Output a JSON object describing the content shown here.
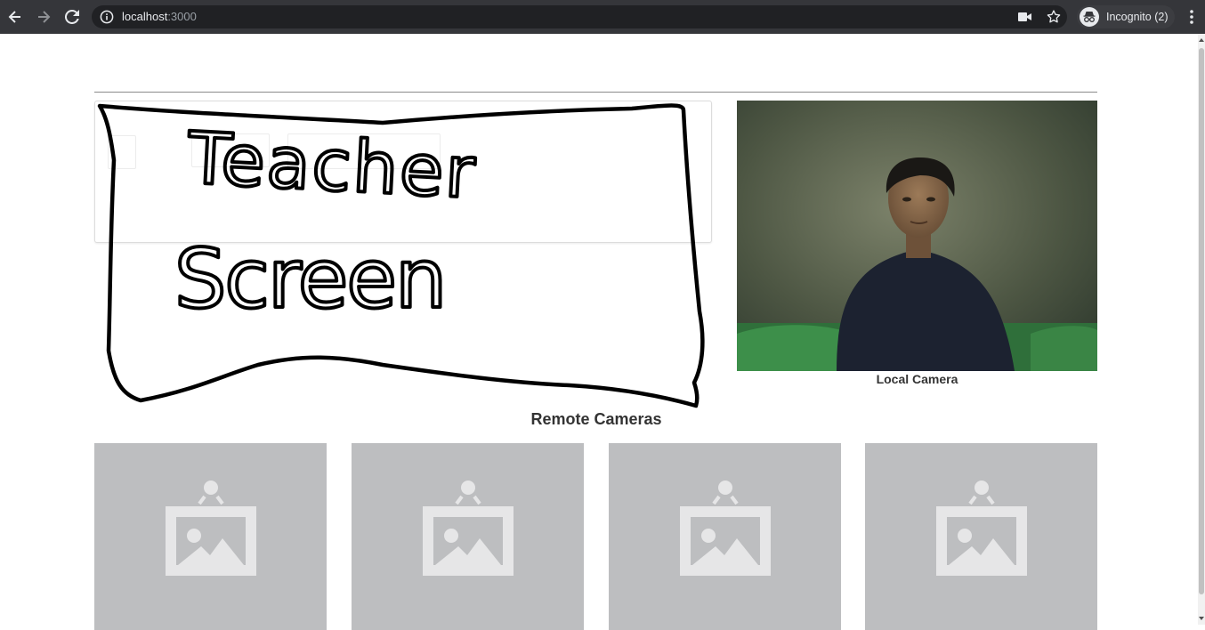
{
  "browser": {
    "url_host": "localhost",
    "url_port": ":3000",
    "profile_label": "Incognito (2)",
    "icons": {
      "back": "back-arrow-icon",
      "forward": "forward-arrow-icon",
      "reload": "reload-icon",
      "site_info": "info-icon",
      "camera_in_use": "video-camera-icon",
      "bookmark": "star-icon",
      "profile": "incognito-icon",
      "menu": "kebab-menu-icon"
    },
    "colors": {
      "chrome_bg": "#35363a",
      "omnibox_bg": "#202124"
    }
  },
  "page": {
    "drawing_text_line1": "Teacher",
    "drawing_text_line2": "Screen",
    "local_camera_label": "Local Camera",
    "remote_cameras_title": "Remote Cameras",
    "remote_tiles": [
      {
        "icon": "image-placeholder-icon"
      },
      {
        "icon": "image-placeholder-icon"
      },
      {
        "icon": "image-placeholder-icon"
      },
      {
        "icon": "image-placeholder-icon"
      }
    ],
    "colors": {
      "tile_bg": "#bdbec0",
      "tile_icon": "#e6e6e7"
    }
  }
}
